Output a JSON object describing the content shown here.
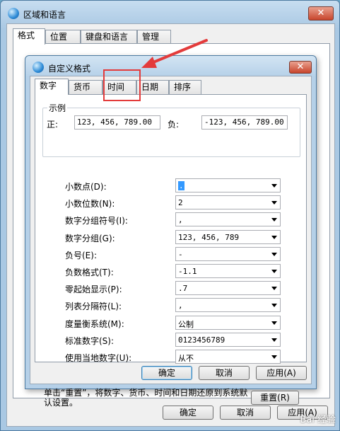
{
  "outer": {
    "title": "区域和语言",
    "close": "✕",
    "tabs": [
      "格式",
      "位置",
      "键盘和语言",
      "管理"
    ],
    "ok": "确定",
    "cancel": "取消",
    "apply": "应用(A)"
  },
  "dialog": {
    "title": "自定义格式",
    "close": "✕",
    "tabs": [
      "数字",
      "货币",
      "时间",
      "日期",
      "排序"
    ],
    "example": {
      "label": "示例",
      "pos_label": "正:",
      "pos_value": "123, 456, 789.00",
      "neg_label": "负:",
      "neg_value": "-123, 456, 789.00"
    },
    "rows": [
      {
        "label": "小数点(D):",
        "value": ".",
        "selected": true
      },
      {
        "label": "小数位数(N):",
        "value": "2"
      },
      {
        "label": "数字分组符号(I):",
        "value": ","
      },
      {
        "label": "数字分组(G):",
        "value": "123, 456, 789"
      },
      {
        "label": "负号(E):",
        "value": "-"
      },
      {
        "label": "负数格式(T):",
        "value": "-1.1"
      },
      {
        "label": "零起始显示(P):",
        "value": ".7"
      },
      {
        "label": "列表分隔符(L):",
        "value": ","
      },
      {
        "label": "度量衡系统(M):",
        "value": "公制"
      },
      {
        "label": "标准数字(S):",
        "value": "0123456789"
      },
      {
        "label": "使用当地数字(U):",
        "value": "从不"
      }
    ],
    "note": "单击“重置”，将数字、货币、时间和日期还原到系统默认设置。",
    "reset": "重置(R)",
    "ok": "确定",
    "cancel": "取消",
    "apply": "应用(A)"
  },
  "watermark": "Bai 经验",
  "colors": {
    "highlight": "#e33b3b",
    "selection": "#3399ff"
  }
}
